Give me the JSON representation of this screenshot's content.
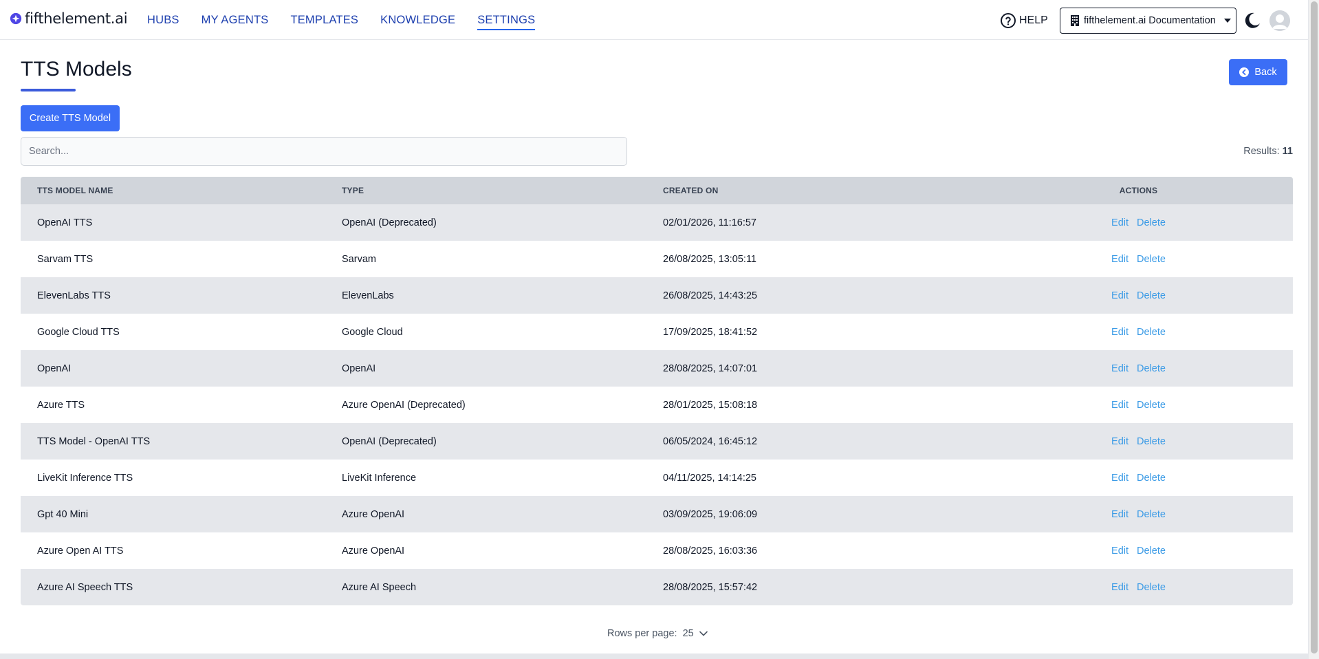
{
  "brand": {
    "name": "fifthelement.ai",
    "accent": "#3b6ef6"
  },
  "nav": [
    {
      "label": "HUBS",
      "active": false
    },
    {
      "label": "MY AGENTS",
      "active": false
    },
    {
      "label": "TEMPLATES",
      "active": false
    },
    {
      "label": "KNOWLEDGE",
      "active": false
    },
    {
      "label": "SETTINGS",
      "active": true
    }
  ],
  "header": {
    "help_label": "HELP",
    "org_label": "fifthelement.ai Documentation"
  },
  "page": {
    "title": "TTS Models",
    "back_label": "Back",
    "create_label": "Create TTS Model",
    "search_placeholder": "Search...",
    "results_label": "Results:",
    "results_count": "11"
  },
  "table": {
    "headers": [
      "TTS MODEL NAME",
      "TYPE",
      "CREATED ON",
      "ACTIONS"
    ],
    "edit_label": "Edit",
    "delete_label": "Delete",
    "rows": [
      {
        "name": "OpenAI TTS",
        "type": "OpenAI (Deprecated)",
        "created": "02/01/2026, 11:16:57"
      },
      {
        "name": "Sarvam TTS",
        "type": "Sarvam",
        "created": "26/08/2025, 13:05:11"
      },
      {
        "name": "ElevenLabs TTS",
        "type": "ElevenLabs",
        "created": "26/08/2025, 14:43:25"
      },
      {
        "name": "Google Cloud TTS",
        "type": "Google Cloud",
        "created": "17/09/2025, 18:41:52"
      },
      {
        "name": "OpenAI",
        "type": "OpenAI",
        "created": "28/08/2025, 14:07:01"
      },
      {
        "name": "Azure TTS",
        "type": "Azure OpenAI (Deprecated)",
        "created": "28/01/2025, 15:08:18"
      },
      {
        "name": "TTS Model - OpenAI TTS",
        "type": "OpenAI (Deprecated)",
        "created": "06/05/2024, 16:45:12"
      },
      {
        "name": "LiveKit Inference TTS",
        "type": "LiveKit Inference",
        "created": "04/11/2025, 14:14:25"
      },
      {
        "name": "Gpt 40 Mini",
        "type": "Azure OpenAI",
        "created": "03/09/2025, 19:06:09"
      },
      {
        "name": "Azure Open AI TTS",
        "type": "Azure OpenAI",
        "created": "28/08/2025, 16:03:36"
      },
      {
        "name": "Azure AI Speech TTS",
        "type": "Azure AI Speech",
        "created": "28/08/2025, 15:57:42"
      }
    ]
  },
  "pagination": {
    "rows_per_page_label": "Rows per page:",
    "rows_per_page_value": "25"
  }
}
